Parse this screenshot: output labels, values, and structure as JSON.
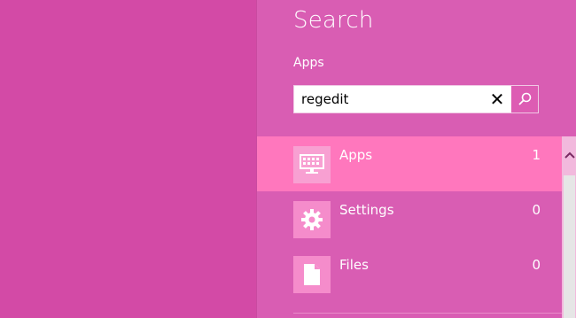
{
  "search": {
    "title": "Search",
    "scope": "Apps",
    "query": "regedit",
    "clear_glyph": "✕"
  },
  "results": [
    {
      "label": "Apps",
      "count": "1",
      "icon": "apps-keyboard-icon",
      "selected": true
    },
    {
      "label": "Settings",
      "count": "0",
      "icon": "gear-icon",
      "selected": false
    },
    {
      "label": "Files",
      "count": "0",
      "icon": "file-icon",
      "selected": false
    }
  ],
  "colors": {
    "background": "#d34aa6",
    "pane": "#d95db3",
    "selected_row": "#ff77bd",
    "tile": "#f58ccb"
  }
}
